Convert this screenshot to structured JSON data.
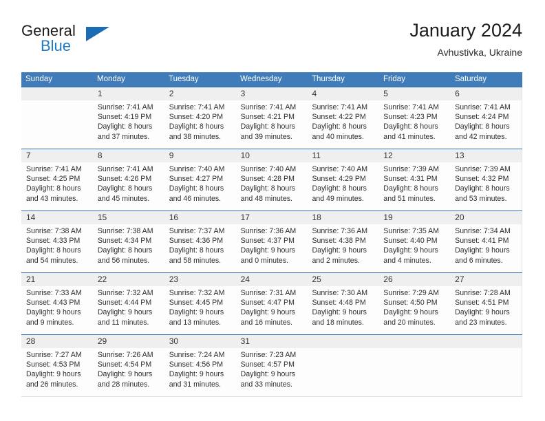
{
  "brand": {
    "word_one": "General",
    "word_two": "Blue",
    "triangle_color": "#1b6cb3",
    "blue_text_color": "#1f79c4"
  },
  "header": {
    "title": "January 2024",
    "subtitle": "Avhustivka, Ukraine"
  },
  "theme": {
    "header_blue": "#3f7cb9",
    "row_rule_blue": "#2f6fae",
    "daynum_band": "#efefef"
  },
  "weekdays": [
    "Sunday",
    "Monday",
    "Tuesday",
    "Wednesday",
    "Thursday",
    "Friday",
    "Saturday"
  ],
  "labels": {
    "sunrise_prefix": "Sunrise:",
    "sunset_prefix": "Sunset:",
    "daylight_prefix": "Daylight:"
  },
  "weeks": [
    {
      "days": [
        {
          "day": "",
          "l1": "",
          "l2": "",
          "l3": "",
          "l4": ""
        },
        {
          "day": "1",
          "l1": "Sunrise: 7:41 AM",
          "l2": "Sunset: 4:19 PM",
          "l3": "Daylight: 8 hours",
          "l4": "and 37 minutes."
        },
        {
          "day": "2",
          "l1": "Sunrise: 7:41 AM",
          "l2": "Sunset: 4:20 PM",
          "l3": "Daylight: 8 hours",
          "l4": "and 38 minutes."
        },
        {
          "day": "3",
          "l1": "Sunrise: 7:41 AM",
          "l2": "Sunset: 4:21 PM",
          "l3": "Daylight: 8 hours",
          "l4": "and 39 minutes."
        },
        {
          "day": "4",
          "l1": "Sunrise: 7:41 AM",
          "l2": "Sunset: 4:22 PM",
          "l3": "Daylight: 8 hours",
          "l4": "and 40 minutes."
        },
        {
          "day": "5",
          "l1": "Sunrise: 7:41 AM",
          "l2": "Sunset: 4:23 PM",
          "l3": "Daylight: 8 hours",
          "l4": "and 41 minutes."
        },
        {
          "day": "6",
          "l1": "Sunrise: 7:41 AM",
          "l2": "Sunset: 4:24 PM",
          "l3": "Daylight: 8 hours",
          "l4": "and 42 minutes."
        }
      ]
    },
    {
      "days": [
        {
          "day": "7",
          "l1": "Sunrise: 7:41 AM",
          "l2": "Sunset: 4:25 PM",
          "l3": "Daylight: 8 hours",
          "l4": "and 43 minutes."
        },
        {
          "day": "8",
          "l1": "Sunrise: 7:41 AM",
          "l2": "Sunset: 4:26 PM",
          "l3": "Daylight: 8 hours",
          "l4": "and 45 minutes."
        },
        {
          "day": "9",
          "l1": "Sunrise: 7:40 AM",
          "l2": "Sunset: 4:27 PM",
          "l3": "Daylight: 8 hours",
          "l4": "and 46 minutes."
        },
        {
          "day": "10",
          "l1": "Sunrise: 7:40 AM",
          "l2": "Sunset: 4:28 PM",
          "l3": "Daylight: 8 hours",
          "l4": "and 48 minutes."
        },
        {
          "day": "11",
          "l1": "Sunrise: 7:40 AM",
          "l2": "Sunset: 4:29 PM",
          "l3": "Daylight: 8 hours",
          "l4": "and 49 minutes."
        },
        {
          "day": "12",
          "l1": "Sunrise: 7:39 AM",
          "l2": "Sunset: 4:31 PM",
          "l3": "Daylight: 8 hours",
          "l4": "and 51 minutes."
        },
        {
          "day": "13",
          "l1": "Sunrise: 7:39 AM",
          "l2": "Sunset: 4:32 PM",
          "l3": "Daylight: 8 hours",
          "l4": "and 53 minutes."
        }
      ]
    },
    {
      "days": [
        {
          "day": "14",
          "l1": "Sunrise: 7:38 AM",
          "l2": "Sunset: 4:33 PM",
          "l3": "Daylight: 8 hours",
          "l4": "and 54 minutes."
        },
        {
          "day": "15",
          "l1": "Sunrise: 7:38 AM",
          "l2": "Sunset: 4:34 PM",
          "l3": "Daylight: 8 hours",
          "l4": "and 56 minutes."
        },
        {
          "day": "16",
          "l1": "Sunrise: 7:37 AM",
          "l2": "Sunset: 4:36 PM",
          "l3": "Daylight: 8 hours",
          "l4": "and 58 minutes."
        },
        {
          "day": "17",
          "l1": "Sunrise: 7:36 AM",
          "l2": "Sunset: 4:37 PM",
          "l3": "Daylight: 9 hours",
          "l4": "and 0 minutes."
        },
        {
          "day": "18",
          "l1": "Sunrise: 7:36 AM",
          "l2": "Sunset: 4:38 PM",
          "l3": "Daylight: 9 hours",
          "l4": "and 2 minutes."
        },
        {
          "day": "19",
          "l1": "Sunrise: 7:35 AM",
          "l2": "Sunset: 4:40 PM",
          "l3": "Daylight: 9 hours",
          "l4": "and 4 minutes."
        },
        {
          "day": "20",
          "l1": "Sunrise: 7:34 AM",
          "l2": "Sunset: 4:41 PM",
          "l3": "Daylight: 9 hours",
          "l4": "and 6 minutes."
        }
      ]
    },
    {
      "days": [
        {
          "day": "21",
          "l1": "Sunrise: 7:33 AM",
          "l2": "Sunset: 4:43 PM",
          "l3": "Daylight: 9 hours",
          "l4": "and 9 minutes."
        },
        {
          "day": "22",
          "l1": "Sunrise: 7:32 AM",
          "l2": "Sunset: 4:44 PM",
          "l3": "Daylight: 9 hours",
          "l4": "and 11 minutes."
        },
        {
          "day": "23",
          "l1": "Sunrise: 7:32 AM",
          "l2": "Sunset: 4:45 PM",
          "l3": "Daylight: 9 hours",
          "l4": "and 13 minutes."
        },
        {
          "day": "24",
          "l1": "Sunrise: 7:31 AM",
          "l2": "Sunset: 4:47 PM",
          "l3": "Daylight: 9 hours",
          "l4": "and 16 minutes."
        },
        {
          "day": "25",
          "l1": "Sunrise: 7:30 AM",
          "l2": "Sunset: 4:48 PM",
          "l3": "Daylight: 9 hours",
          "l4": "and 18 minutes."
        },
        {
          "day": "26",
          "l1": "Sunrise: 7:29 AM",
          "l2": "Sunset: 4:50 PM",
          "l3": "Daylight: 9 hours",
          "l4": "and 20 minutes."
        },
        {
          "day": "27",
          "l1": "Sunrise: 7:28 AM",
          "l2": "Sunset: 4:51 PM",
          "l3": "Daylight: 9 hours",
          "l4": "and 23 minutes."
        }
      ]
    },
    {
      "days": [
        {
          "day": "28",
          "l1": "Sunrise: 7:27 AM",
          "l2": "Sunset: 4:53 PM",
          "l3": "Daylight: 9 hours",
          "l4": "and 26 minutes."
        },
        {
          "day": "29",
          "l1": "Sunrise: 7:26 AM",
          "l2": "Sunset: 4:54 PM",
          "l3": "Daylight: 9 hours",
          "l4": "and 28 minutes."
        },
        {
          "day": "30",
          "l1": "Sunrise: 7:24 AM",
          "l2": "Sunset: 4:56 PM",
          "l3": "Daylight: 9 hours",
          "l4": "and 31 minutes."
        },
        {
          "day": "31",
          "l1": "Sunrise: 7:23 AM",
          "l2": "Sunset: 4:57 PM",
          "l3": "Daylight: 9 hours",
          "l4": "and 33 minutes."
        },
        {
          "day": "",
          "l1": "",
          "l2": "",
          "l3": "",
          "l4": ""
        },
        {
          "day": "",
          "l1": "",
          "l2": "",
          "l3": "",
          "l4": ""
        },
        {
          "day": "",
          "l1": "",
          "l2": "",
          "l3": "",
          "l4": ""
        }
      ]
    }
  ]
}
